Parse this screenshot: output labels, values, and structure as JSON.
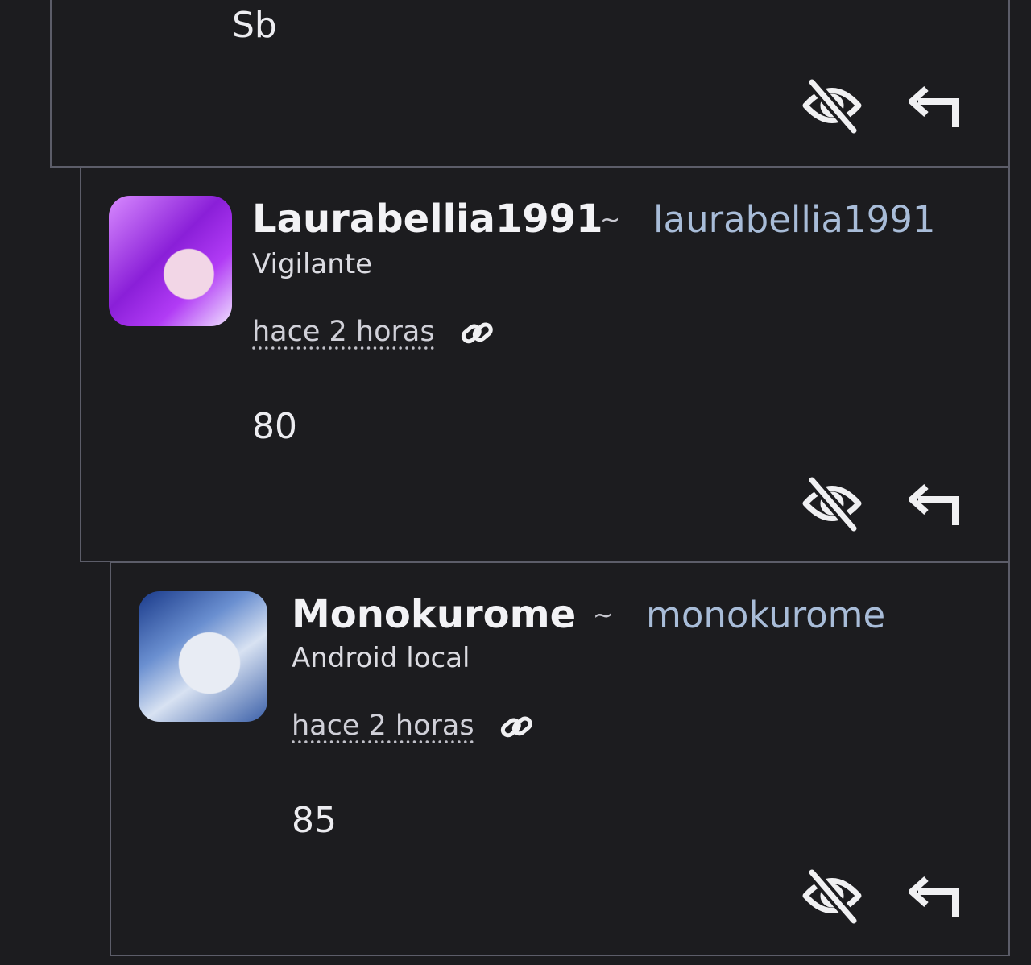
{
  "comments": [
    {
      "text": "Sb",
      "actions": {
        "hide_icon": "eye-off-icon",
        "reply_icon": "reply-arrow-icon"
      }
    },
    {
      "display_name": "Laurabellia1991",
      "separator": "~",
      "handle": "laurabellia1991",
      "role": "Vigilante",
      "time": "hace 2 horas",
      "text": "80",
      "actions": {
        "link_icon": "link-icon",
        "hide_icon": "eye-off-icon",
        "reply_icon": "reply-arrow-icon"
      }
    },
    {
      "display_name": "Monokurome",
      "separator": "~",
      "handle": "monokurome",
      "role": "Android local",
      "time": "hace 2 horas",
      "text": "85",
      "actions": {
        "link_icon": "link-icon",
        "hide_icon": "eye-off-icon",
        "reply_icon": "reply-arrow-icon"
      }
    }
  ],
  "colors": {
    "background": "#1c1c1f",
    "border": "#5c5d69",
    "handle": "#a8bcd8",
    "text": "#e8e8ec"
  }
}
